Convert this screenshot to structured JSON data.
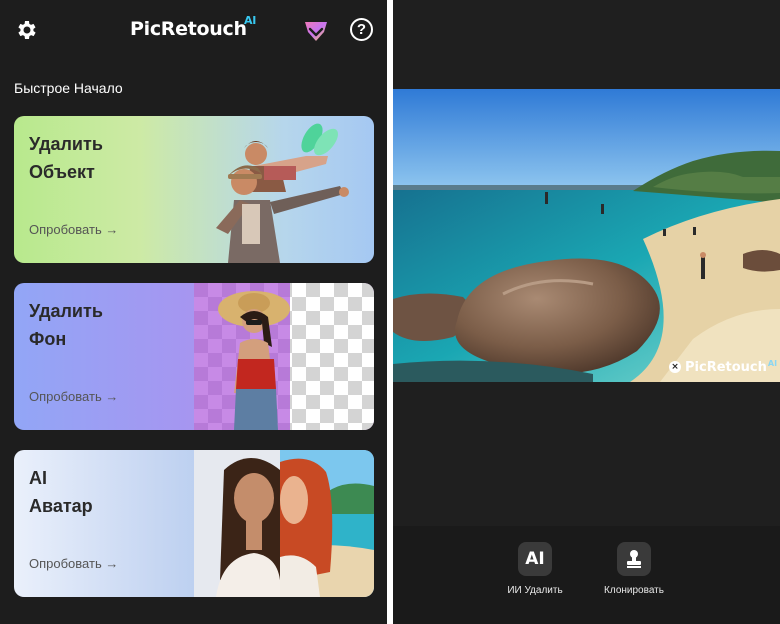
{
  "app": {
    "logo_text": "PicRetouch",
    "logo_badge": "AI",
    "help_symbol": "?",
    "brand_accent": "#38c8f0"
  },
  "icons": {
    "settings": "gear-icon",
    "premium": "gem-icon",
    "help": "help-circle-icon",
    "ai_remove": "ai-icon",
    "clone": "stamp-icon",
    "watermark_close": "close-icon"
  },
  "quick_start": {
    "title": "Быстрое Начало",
    "cards": [
      {
        "title": "Удалить\nОбъект",
        "action": "Опробовать →"
      },
      {
        "title": "Удалить\nФон",
        "action": "Опробовать →"
      },
      {
        "title": "AI\nАватар",
        "action": "Опробовать →"
      }
    ]
  },
  "editor": {
    "watermark": "PicRetouch",
    "watermark_badge": "AI",
    "watermark_close": "×",
    "tools": [
      {
        "icon_text": "AI",
        "label": "ИИ Удалить"
      },
      {
        "icon_text": "",
        "label": "Клонировать"
      }
    ]
  }
}
